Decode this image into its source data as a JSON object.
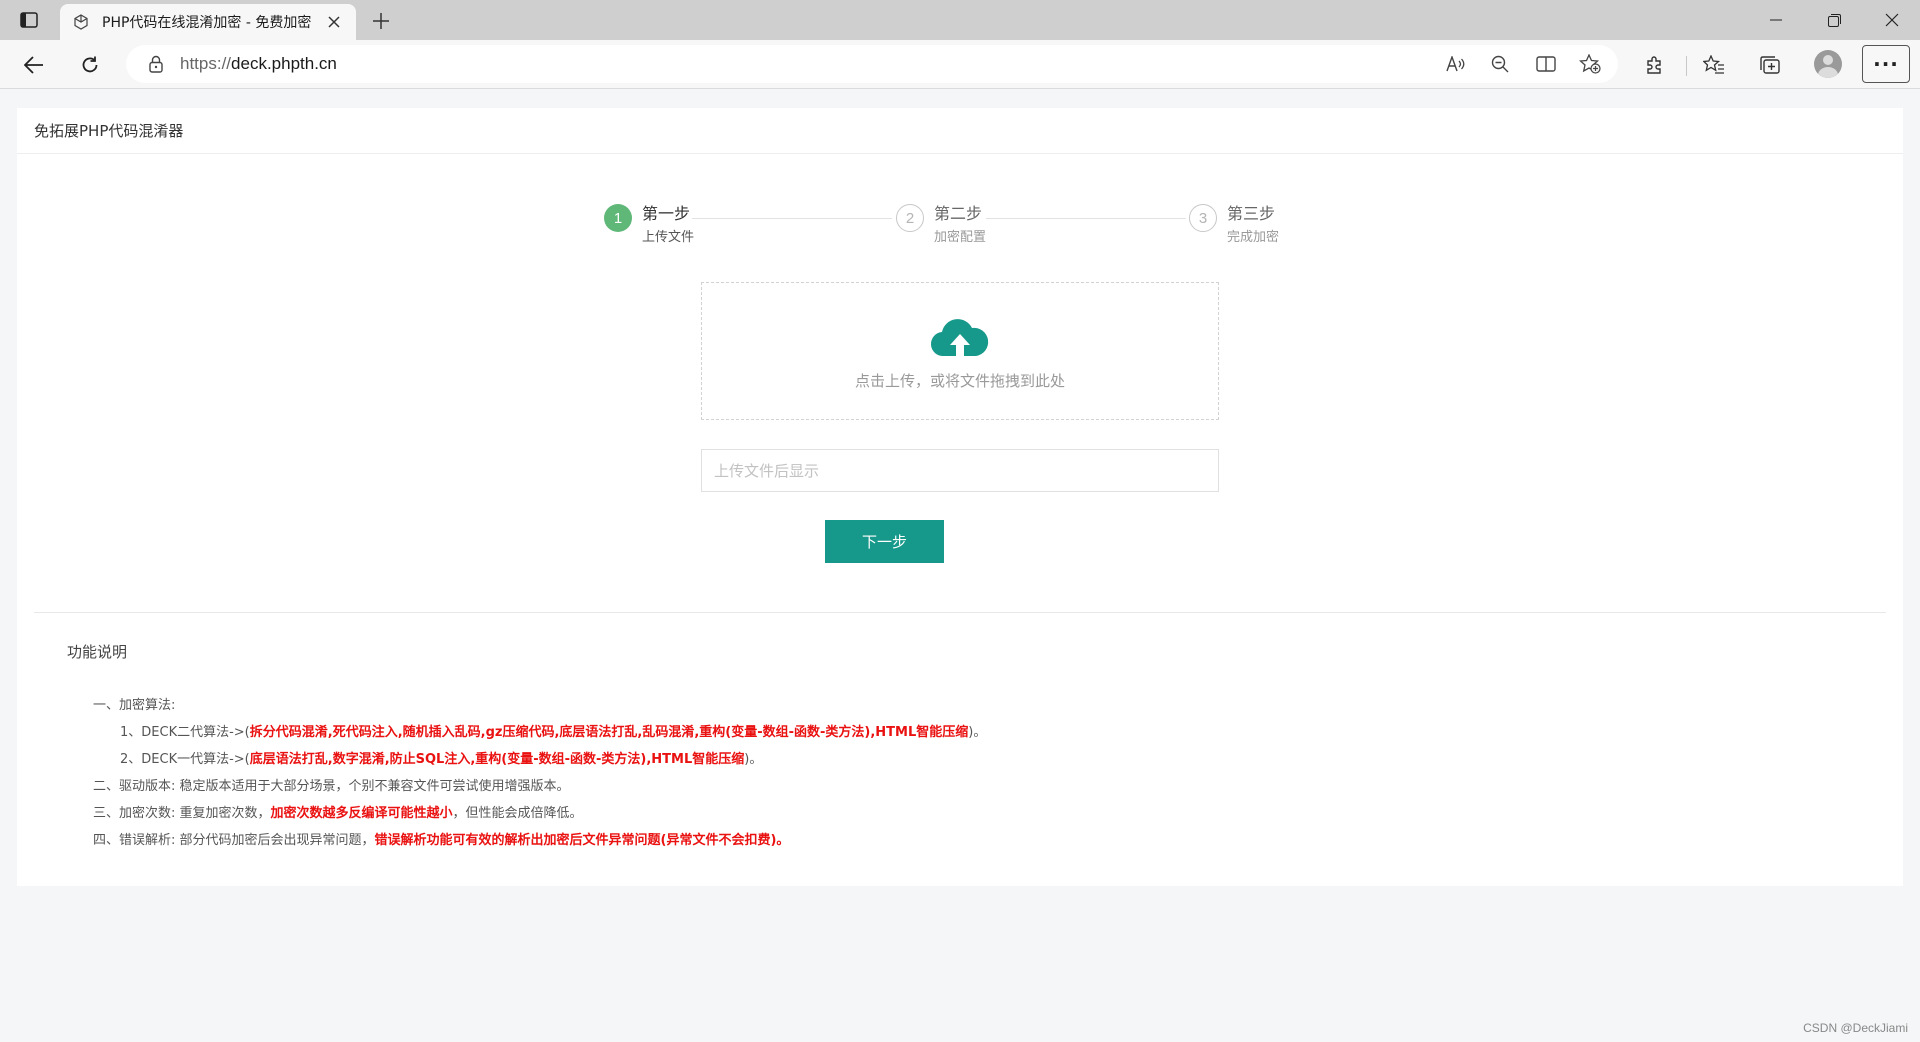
{
  "browser": {
    "tab_title": "PHP代码在线混淆加密 - 免费加密",
    "url_scheme": "https://",
    "url_host": "deck.phpth.cn"
  },
  "page": {
    "header_title": "免拓展PHP代码混淆器",
    "steps": [
      {
        "num": "1",
        "title": "第一步",
        "desc": "上传文件",
        "state": "active"
      },
      {
        "num": "2",
        "title": "第二步",
        "desc": "加密配置",
        "state": "idle"
      },
      {
        "num": "3",
        "title": "第三步",
        "desc": "完成加密",
        "state": "idle"
      }
    ],
    "upload_hint": "点击上传，或将文件拖拽到此处",
    "result_placeholder": "上传文件后显示",
    "next_label": "下一步",
    "func_title": "功能说明",
    "func_items": {
      "l1": "一、加密算法:",
      "l2_prefix": "1、DECK二代算法->(",
      "l2_red": "拆分代码混淆,死代码注入,随机插入乱码,gz压缩代码,底层语法打乱,乱码混淆,重构(变量-数组-函数-类方法),HTML智能压缩",
      "l2_suffix": ")。",
      "l3_prefix": "2、DECK一代算法->(",
      "l3_red": "底层语法打乱,数字混淆,防止SQL注入,重构(变量-数组-函数-类方法),HTML智能压缩",
      "l3_suffix": ")。",
      "l4": "二、驱动版本: 稳定版本适用于大部分场景，个别不兼容文件可尝试使用增强版本。",
      "l5_prefix": "三、加密次数: 重复加密次数，",
      "l5_red": "加密次数越多反编译可能性越小",
      "l5_suffix": "，但性能会成倍降低。",
      "l6_prefix": "四、错误解析: 部分代码加密后会出现异常问题，",
      "l6_red": "错误解析功能可有效的解析出加密后文件异常问题(异常文件不会扣费)。"
    },
    "watermark": "CSDN @DeckJiami"
  },
  "colors": {
    "accent": "#16998a",
    "step_active": "#5fb878",
    "highlight_red": "#ea1111"
  }
}
